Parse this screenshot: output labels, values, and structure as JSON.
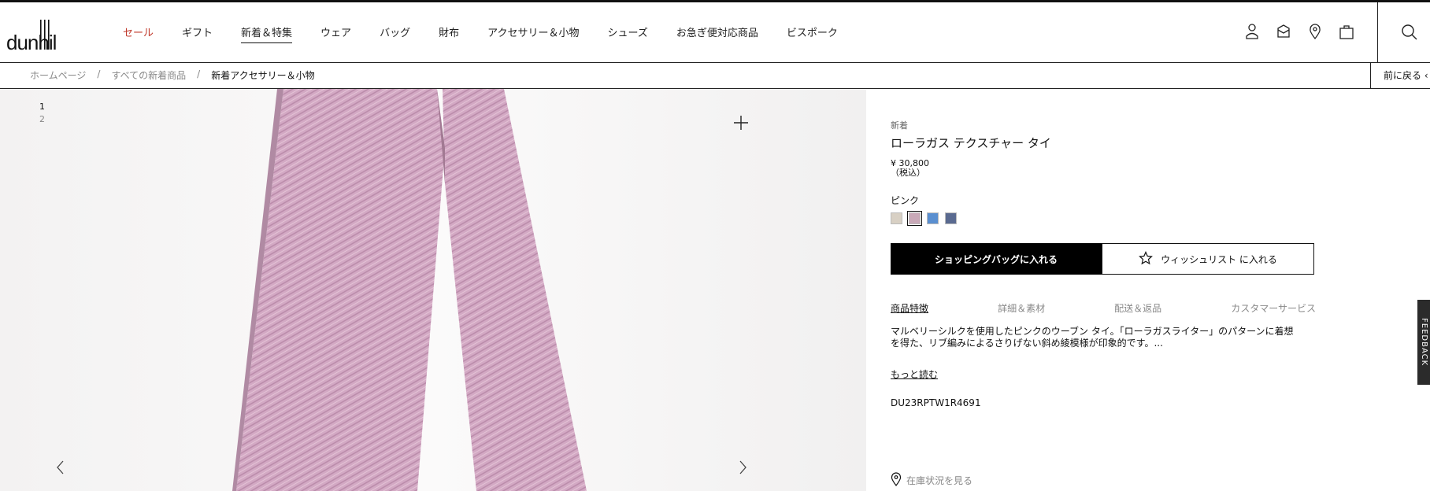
{
  "brand": "dunhill",
  "nav": {
    "items": [
      "セール",
      "ギフト",
      "新着＆特集",
      "ウェア",
      "バッグ",
      "財布",
      "アクセサリー＆小物",
      "シューズ",
      "お急ぎ便対応商品",
      "ビスポーク"
    ],
    "sale_color": "#c0392b"
  },
  "header_icons": [
    "account-icon",
    "mail-icon",
    "location-icon",
    "shopping-bag-icon",
    "search-icon"
  ],
  "breadcrumb": {
    "items": [
      "ホームページ",
      "/",
      "すべての新着商品",
      "/",
      "新着アクセサリー＆小物"
    ],
    "back": "前に戻る ‹"
  },
  "gallery": {
    "pages": [
      "1",
      "2"
    ],
    "image": "pink-textured-tie"
  },
  "product": {
    "badge": "新着",
    "title": "ローラガス テクスチャー タイ",
    "price": "¥ 30,800",
    "tax": "（税込）",
    "color_name": "ピンク",
    "swatches": [
      "#d8d0c4",
      "#c9a9b8",
      "#5a8fd0",
      "#5a6a90"
    ],
    "add_to_bag": "ショッピングバッグに入れる",
    "wishlist": "ウィッシュリスト に入れる",
    "tabs": [
      "商品特徴",
      "詳細＆素材",
      "配送＆返品",
      "カスタマーサービス"
    ],
    "description_line1": "マルベリーシルクを使用したピンクのウーブン タイ。「ローラガスライター」のパターンに着想",
    "description_line2": "を得た、リブ編みによるさりげない斜め綾模様が印象的です。...",
    "read_more": "もっと読む",
    "sku": "DU23RPTW1R4691",
    "stock": "在庫状況を見る"
  },
  "feedback": "FEEDBACK"
}
